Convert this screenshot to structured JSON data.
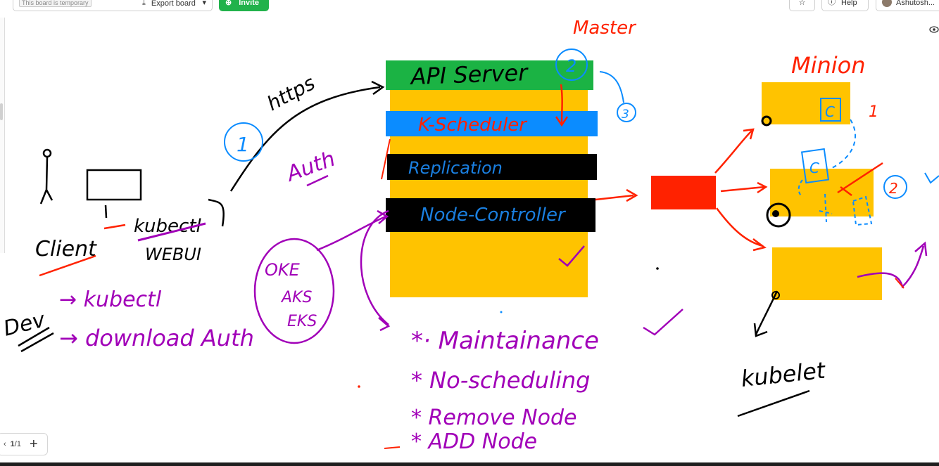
{
  "toolbar": {
    "board_tag": "This board is temporary",
    "export_label": "Export board",
    "invite_label": "Invite",
    "help_label": "Help",
    "user_name": "Ashutosh..."
  },
  "pager": {
    "page": "1",
    "total": "/1"
  },
  "canvas": {
    "master": "Master",
    "minion": "Minion",
    "https": "https",
    "auth": "Auth",
    "api_server": "API Server",
    "k_scheduler": "K-Scheduler",
    "replication": "Replication",
    "node_controller": "Node-Controller",
    "client": "Client",
    "kubectl_webui_1": "kubectl",
    "kubectl_webui_2": "WEBUI",
    "dev": "Dev",
    "dev_item_1": "→ kubectl",
    "dev_item_2": "→ download Auth",
    "oke_1": "OKE",
    "oke_2": "AKS",
    "oke_3": "EKS",
    "todo_1": "*· Maintainance",
    "todo_2": "*  No-scheduling",
    "todo_3": "*   Remove  Node",
    "todo_4": "*   ADD    Node",
    "kubelet": "kubelet",
    "num_1": "1",
    "num_2": "2",
    "num_3": "3",
    "c_label": "C",
    "minion_num_1": "1",
    "minion_num_2": "2"
  },
  "colors": {
    "yellow": "#FFC300",
    "green": "#1BB344",
    "blue": "#0B8CFF",
    "black": "#000000",
    "red": "#FF2200",
    "purple": "#A100B8",
    "ink_blue": "#1A7FE0",
    "ink_red": "#FF2A1A"
  }
}
